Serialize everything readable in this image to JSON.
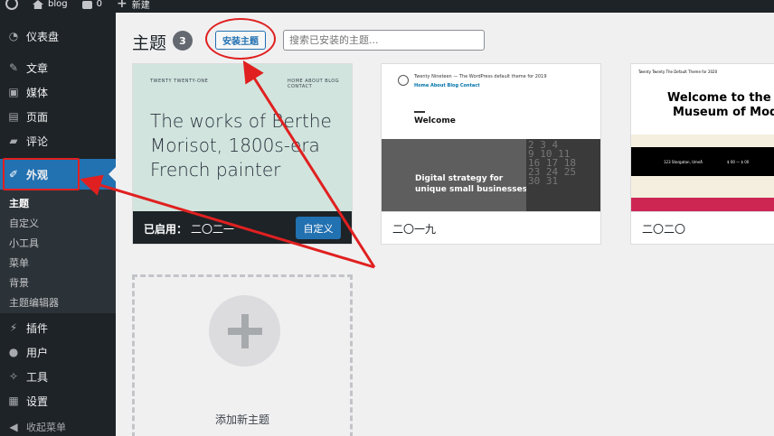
{
  "adminbar": {
    "site_name": "blog",
    "comments_count": "0",
    "new_label": "新建"
  },
  "sidebar": {
    "items": [
      {
        "label": "仪表盘",
        "icon": "dashboard-icon"
      },
      {
        "label": "文章",
        "icon": "pin-icon"
      },
      {
        "label": "媒体",
        "icon": "media-icon"
      },
      {
        "label": "页面",
        "icon": "page-icon"
      },
      {
        "label": "评论",
        "icon": "comment-icon"
      },
      {
        "label": "外观",
        "icon": "appearance-brush-icon"
      },
      {
        "label": "插件",
        "icon": "plugin-icon"
      },
      {
        "label": "用户",
        "icon": "user-icon"
      },
      {
        "label": "工具",
        "icon": "wrench-icon"
      },
      {
        "label": "设置",
        "icon": "settings-icon"
      }
    ],
    "submenu": [
      "主题",
      "自定义",
      "小工具",
      "菜单",
      "背景",
      "主题编辑器"
    ],
    "collapse_label": "收起菜单"
  },
  "header": {
    "title": "主题",
    "count": "3",
    "install_button": "安装主题",
    "search_placeholder": "搜索已安装的主题..."
  },
  "themes": [
    {
      "name": "二〇二一",
      "active_prefix": "已启用：",
      "customize_button": "自定义",
      "preview": {
        "site_title": "TWENTY TWENTY-ONE",
        "menu": "HOME   ABOUT   BLOG   CONTACT",
        "heading": "The works of Berthe Morisot, 1800s-era French painter"
      }
    },
    {
      "name": "二〇一九",
      "preview": {
        "site_title": "Twenty Nineteen — The WordPress default theme for 2019",
        "menu": "Home  About  Blog  Contact",
        "welcome": "Welcome",
        "hero": "Digital strategy for unique small businesses",
        "calendar_numbers": "2 3 4\n9 10 11\n16 17 18\n23 24 25\n30 31"
      }
    },
    {
      "name": "二〇二〇",
      "preview": {
        "site_title": "Twenty Twenty   The Default Theme for 2020",
        "heading_line1": "Welcome to the Sw",
        "heading_line2": "Museum of Mode",
        "address": "123 Storgatan, Umeå",
        "price": "$ 00 — $ 00"
      }
    }
  ],
  "add_new": {
    "label": "添加新主题"
  },
  "colors": {
    "sidebar_bg": "#1d2327",
    "accent": "#2271b1",
    "annotation_red": "#e02020",
    "page_bg": "#f0f0f1"
  }
}
